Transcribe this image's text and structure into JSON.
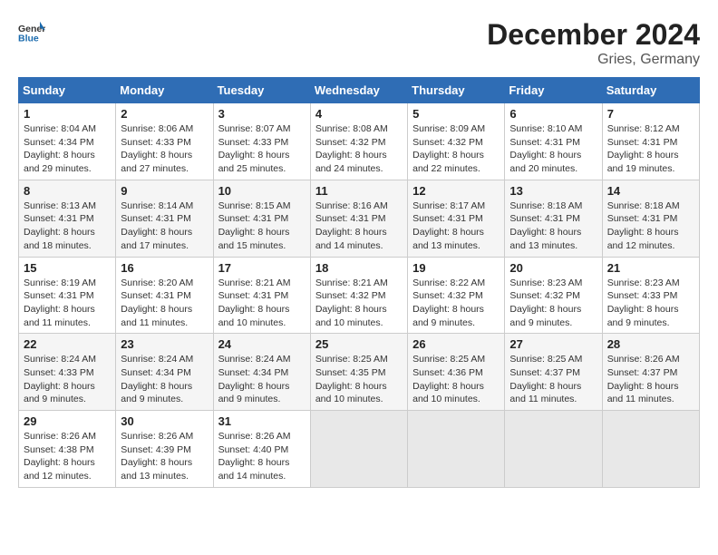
{
  "header": {
    "logo_line1": "General",
    "logo_line2": "Blue",
    "month": "December 2024",
    "location": "Gries, Germany"
  },
  "weekdays": [
    "Sunday",
    "Monday",
    "Tuesday",
    "Wednesday",
    "Thursday",
    "Friday",
    "Saturday"
  ],
  "weeks": [
    [
      {
        "day": "1",
        "sunrise": "8:04 AM",
        "sunset": "4:34 PM",
        "daylight": "8 hours and 29 minutes."
      },
      {
        "day": "2",
        "sunrise": "8:06 AM",
        "sunset": "4:33 PM",
        "daylight": "8 hours and 27 minutes."
      },
      {
        "day": "3",
        "sunrise": "8:07 AM",
        "sunset": "4:33 PM",
        "daylight": "8 hours and 25 minutes."
      },
      {
        "day": "4",
        "sunrise": "8:08 AM",
        "sunset": "4:32 PM",
        "daylight": "8 hours and 24 minutes."
      },
      {
        "day": "5",
        "sunrise": "8:09 AM",
        "sunset": "4:32 PM",
        "daylight": "8 hours and 22 minutes."
      },
      {
        "day": "6",
        "sunrise": "8:10 AM",
        "sunset": "4:31 PM",
        "daylight": "8 hours and 20 minutes."
      },
      {
        "day": "7",
        "sunrise": "8:12 AM",
        "sunset": "4:31 PM",
        "daylight": "8 hours and 19 minutes."
      }
    ],
    [
      {
        "day": "8",
        "sunrise": "8:13 AM",
        "sunset": "4:31 PM",
        "daylight": "8 hours and 18 minutes."
      },
      {
        "day": "9",
        "sunrise": "8:14 AM",
        "sunset": "4:31 PM",
        "daylight": "8 hours and 17 minutes."
      },
      {
        "day": "10",
        "sunrise": "8:15 AM",
        "sunset": "4:31 PM",
        "daylight": "8 hours and 15 minutes."
      },
      {
        "day": "11",
        "sunrise": "8:16 AM",
        "sunset": "4:31 PM",
        "daylight": "8 hours and 14 minutes."
      },
      {
        "day": "12",
        "sunrise": "8:17 AM",
        "sunset": "4:31 PM",
        "daylight": "8 hours and 13 minutes."
      },
      {
        "day": "13",
        "sunrise": "8:18 AM",
        "sunset": "4:31 PM",
        "daylight": "8 hours and 13 minutes."
      },
      {
        "day": "14",
        "sunrise": "8:18 AM",
        "sunset": "4:31 PM",
        "daylight": "8 hours and 12 minutes."
      }
    ],
    [
      {
        "day": "15",
        "sunrise": "8:19 AM",
        "sunset": "4:31 PM",
        "daylight": "8 hours and 11 minutes."
      },
      {
        "day": "16",
        "sunrise": "8:20 AM",
        "sunset": "4:31 PM",
        "daylight": "8 hours and 11 minutes."
      },
      {
        "day": "17",
        "sunrise": "8:21 AM",
        "sunset": "4:31 PM",
        "daylight": "8 hours and 10 minutes."
      },
      {
        "day": "18",
        "sunrise": "8:21 AM",
        "sunset": "4:32 PM",
        "daylight": "8 hours and 10 minutes."
      },
      {
        "day": "19",
        "sunrise": "8:22 AM",
        "sunset": "4:32 PM",
        "daylight": "8 hours and 9 minutes."
      },
      {
        "day": "20",
        "sunrise": "8:23 AM",
        "sunset": "4:32 PM",
        "daylight": "8 hours and 9 minutes."
      },
      {
        "day": "21",
        "sunrise": "8:23 AM",
        "sunset": "4:33 PM",
        "daylight": "8 hours and 9 minutes."
      }
    ],
    [
      {
        "day": "22",
        "sunrise": "8:24 AM",
        "sunset": "4:33 PM",
        "daylight": "8 hours and 9 minutes."
      },
      {
        "day": "23",
        "sunrise": "8:24 AM",
        "sunset": "4:34 PM",
        "daylight": "8 hours and 9 minutes."
      },
      {
        "day": "24",
        "sunrise": "8:24 AM",
        "sunset": "4:34 PM",
        "daylight": "8 hours and 9 minutes."
      },
      {
        "day": "25",
        "sunrise": "8:25 AM",
        "sunset": "4:35 PM",
        "daylight": "8 hours and 10 minutes."
      },
      {
        "day": "26",
        "sunrise": "8:25 AM",
        "sunset": "4:36 PM",
        "daylight": "8 hours and 10 minutes."
      },
      {
        "day": "27",
        "sunrise": "8:25 AM",
        "sunset": "4:37 PM",
        "daylight": "8 hours and 11 minutes."
      },
      {
        "day": "28",
        "sunrise": "8:26 AM",
        "sunset": "4:37 PM",
        "daylight": "8 hours and 11 minutes."
      }
    ],
    [
      {
        "day": "29",
        "sunrise": "8:26 AM",
        "sunset": "4:38 PM",
        "daylight": "8 hours and 12 minutes."
      },
      {
        "day": "30",
        "sunrise": "8:26 AM",
        "sunset": "4:39 PM",
        "daylight": "8 hours and 13 minutes."
      },
      {
        "day": "31",
        "sunrise": "8:26 AM",
        "sunset": "4:40 PM",
        "daylight": "8 hours and 14 minutes."
      },
      null,
      null,
      null,
      null
    ]
  ],
  "labels": {
    "sunrise": "Sunrise:",
    "sunset": "Sunset:",
    "daylight": "Daylight:"
  }
}
